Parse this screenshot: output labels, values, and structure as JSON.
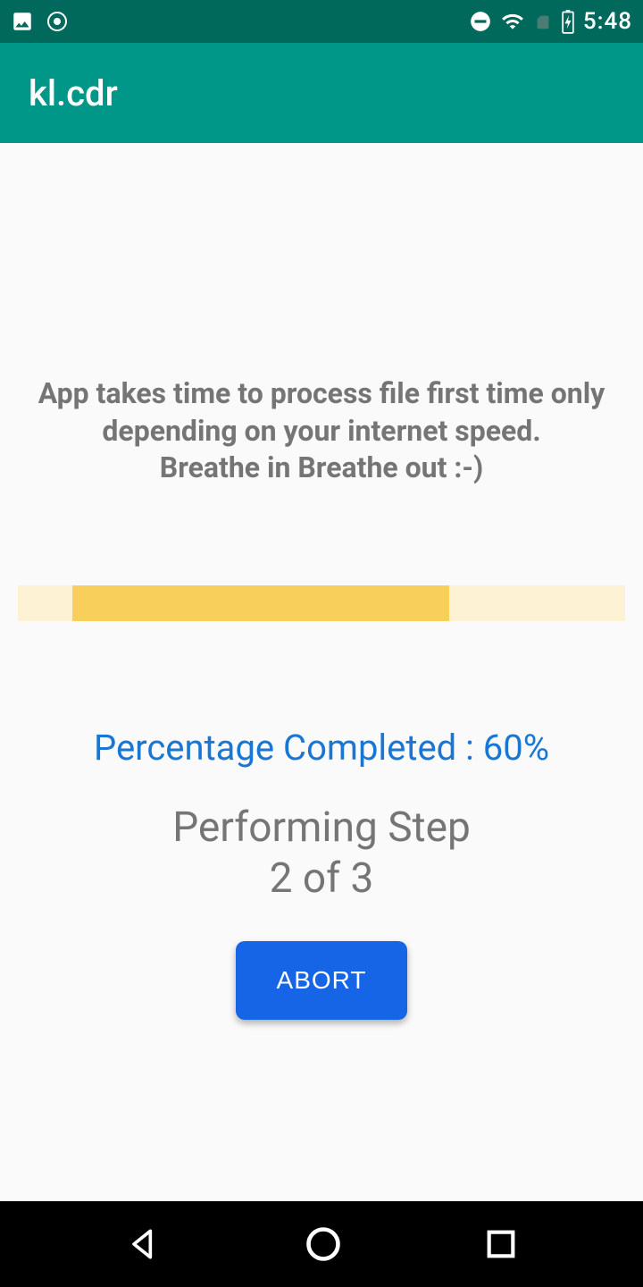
{
  "status_bar": {
    "time": "5:48"
  },
  "app_bar": {
    "title": "kl.cdr"
  },
  "content": {
    "info_line1": "App takes time to process file first time only",
    "info_line2": "depending on your internet speed.",
    "info_line3": "Breathe in Breathe out :-)",
    "percentage_label": "Percentage Completed : 60%",
    "percentage_value": 60,
    "step_line1": "Performing Step",
    "step_line2": "2 of 3",
    "current_step": 2,
    "total_steps": 3,
    "abort_label": "ABORT"
  }
}
